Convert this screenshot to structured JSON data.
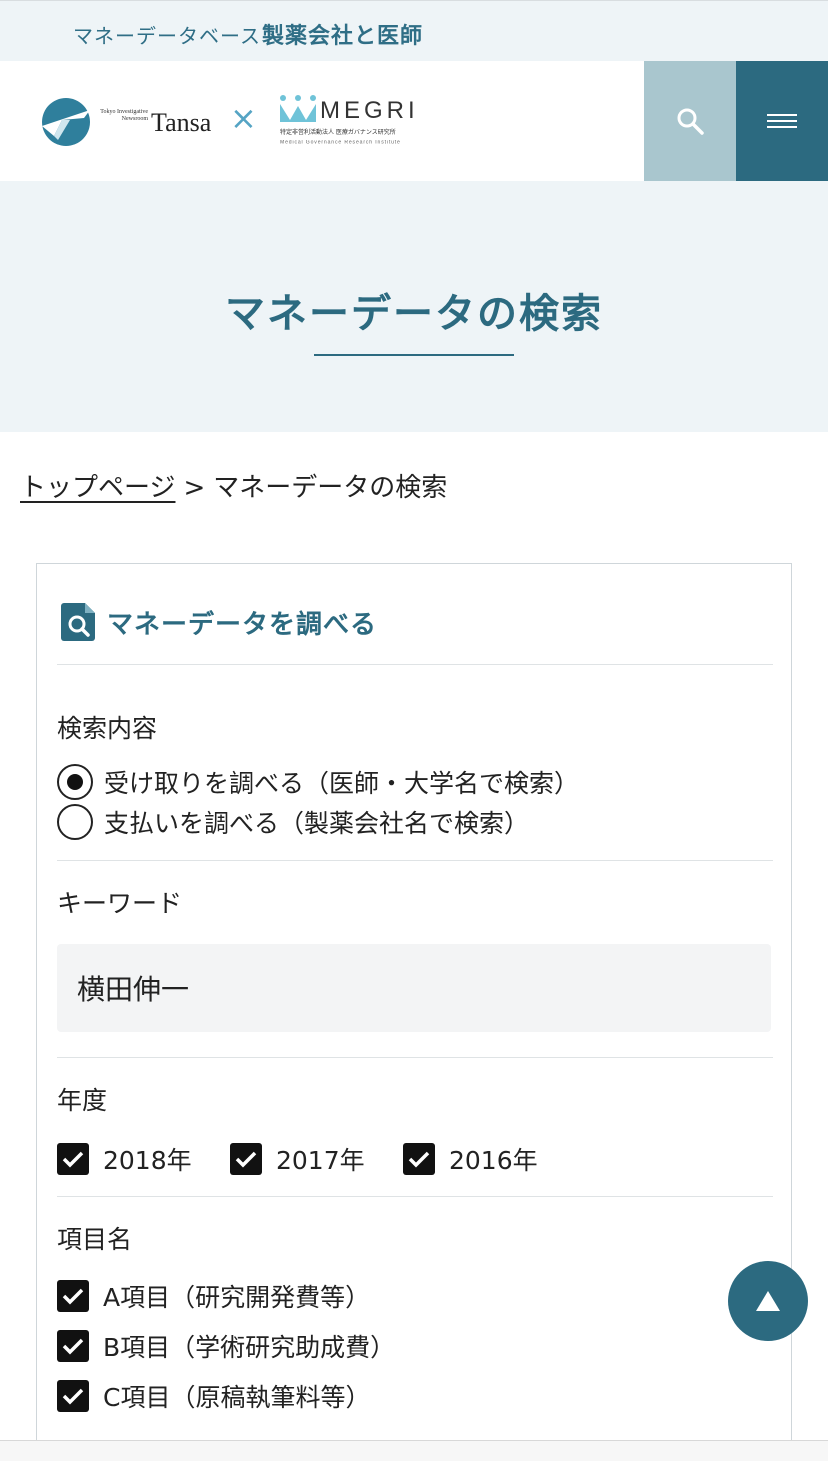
{
  "topbar": {
    "label": "マネーデータベース",
    "title": "製薬会社と医師"
  },
  "header": {
    "tansa_small": "Tokyo Investigative Newsroom",
    "tansa_word": "Tansa",
    "cross": "×",
    "megri_word": "MEGRI",
    "megri_sub1": "特定非営利活動法人 医療ガバナンス研究所",
    "megri_sub2": "Medical Governance Research Institute",
    "search_icon": "search-icon",
    "menu_icon": "hamburger-menu-icon"
  },
  "hero": {
    "title": "マネーデータの検索"
  },
  "breadcrumb": {
    "home": "トップページ",
    "separator": ">",
    "current": "マネーデータの検索"
  },
  "form": {
    "title": "マネーデータを調べる",
    "search_type": {
      "label": "検索内容",
      "options": [
        {
          "label": "受け取りを調べる（医師・大学名で検索）",
          "selected": true
        },
        {
          "label": "支払いを調べる（製薬会社名で検索）",
          "selected": false
        }
      ]
    },
    "keyword": {
      "label": "キーワード",
      "value": "横田伸一"
    },
    "year": {
      "label": "年度",
      "options": [
        {
          "label": "2018年",
          "checked": true
        },
        {
          "label": "2017年",
          "checked": true
        },
        {
          "label": "2016年",
          "checked": true
        }
      ]
    },
    "category": {
      "label": "項目名",
      "options": [
        {
          "label": "A項目（研究開発費等）",
          "checked": true
        },
        {
          "label": "B項目（学術研究助成費）",
          "checked": true
        },
        {
          "label": "C項目（原稿執筆料等）",
          "checked": true
        }
      ]
    }
  },
  "colors": {
    "brand": "#2c6a80",
    "search_button_bg": "#a9c6ce",
    "hero_bg": "#eef4f7"
  }
}
